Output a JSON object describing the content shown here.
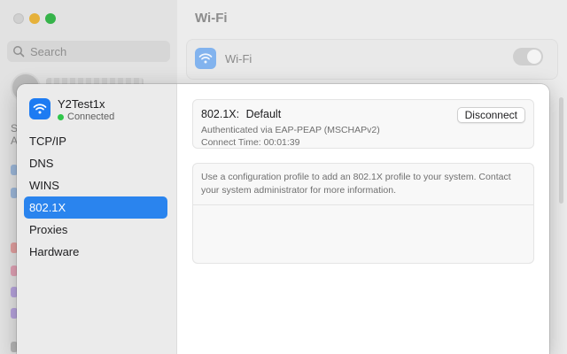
{
  "background": {
    "search_placeholder": "Search",
    "window_title": "Wi-Fi",
    "wifi_label": "Wi-Fi",
    "sidebar_letters": [
      "S",
      "A"
    ]
  },
  "sheet": {
    "network": {
      "name": "Y2Test1x",
      "status": "Connected"
    },
    "nav": [
      {
        "label": "TCP/IP",
        "active": false
      },
      {
        "label": "DNS",
        "active": false
      },
      {
        "label": "WINS",
        "active": false
      },
      {
        "label": "802.1X",
        "active": true
      },
      {
        "label": "Proxies",
        "active": false
      },
      {
        "label": "Hardware",
        "active": false
      }
    ],
    "auth": {
      "key": "802.1X:",
      "value": "Default",
      "method": "Authenticated via EAP-PEAP (MSCHAPv2)",
      "connect_time": "Connect Time: 00:01:39",
      "disconnect_label": "Disconnect"
    },
    "profile_note": "Use a configuration profile to add an 802.1X profile to your system. Contact your system administrator for more information."
  },
  "colors": {
    "accent": "#2a84ee",
    "wifi_icon": "#1d7bf2",
    "status_connected": "#30c64a"
  }
}
